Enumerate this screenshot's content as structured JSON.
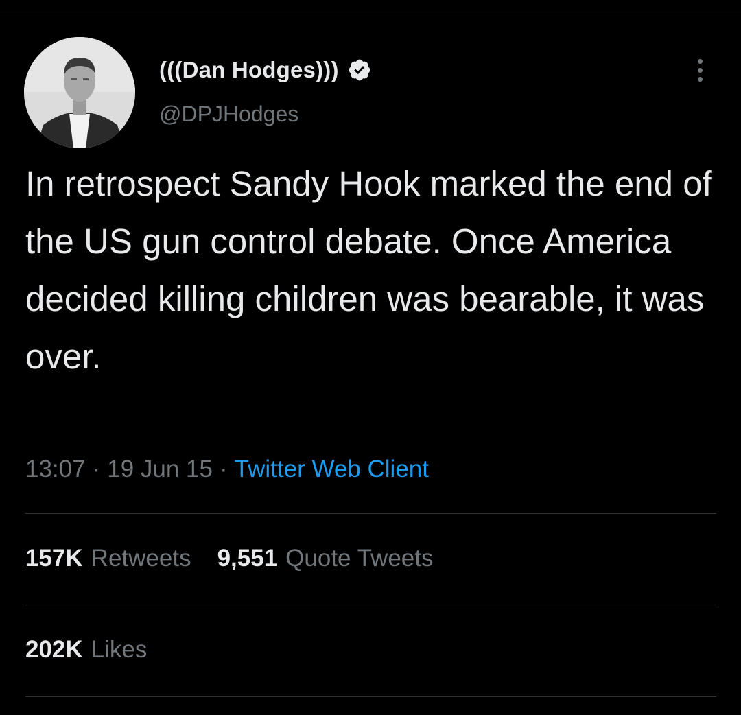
{
  "tweet": {
    "author": {
      "display_name": "(((Dan Hodges)))",
      "handle": "@DPJHodges",
      "verified": true
    },
    "text": "In retrospect Sandy Hook marked the end of the US gun control debate. Once America decided killing children was bearable, it was over.",
    "meta": {
      "time": "13:07",
      "date": "19 Jun 15",
      "client": "Twitter Web Client",
      "separator": "·"
    },
    "stats": {
      "retweets_count": "157K",
      "retweets_label": "Retweets",
      "quotes_count": "9,551",
      "quotes_label": "Quote Tweets",
      "likes_count": "202K",
      "likes_label": "Likes"
    }
  },
  "icons": {
    "verified": "verified-badge-icon",
    "more": "more-vertical-icon"
  },
  "colors": {
    "background": "#000000",
    "text_primary": "#e7e9ea",
    "text_secondary": "#71767b",
    "link": "#1d9bf0",
    "divider": "#2f3336"
  }
}
